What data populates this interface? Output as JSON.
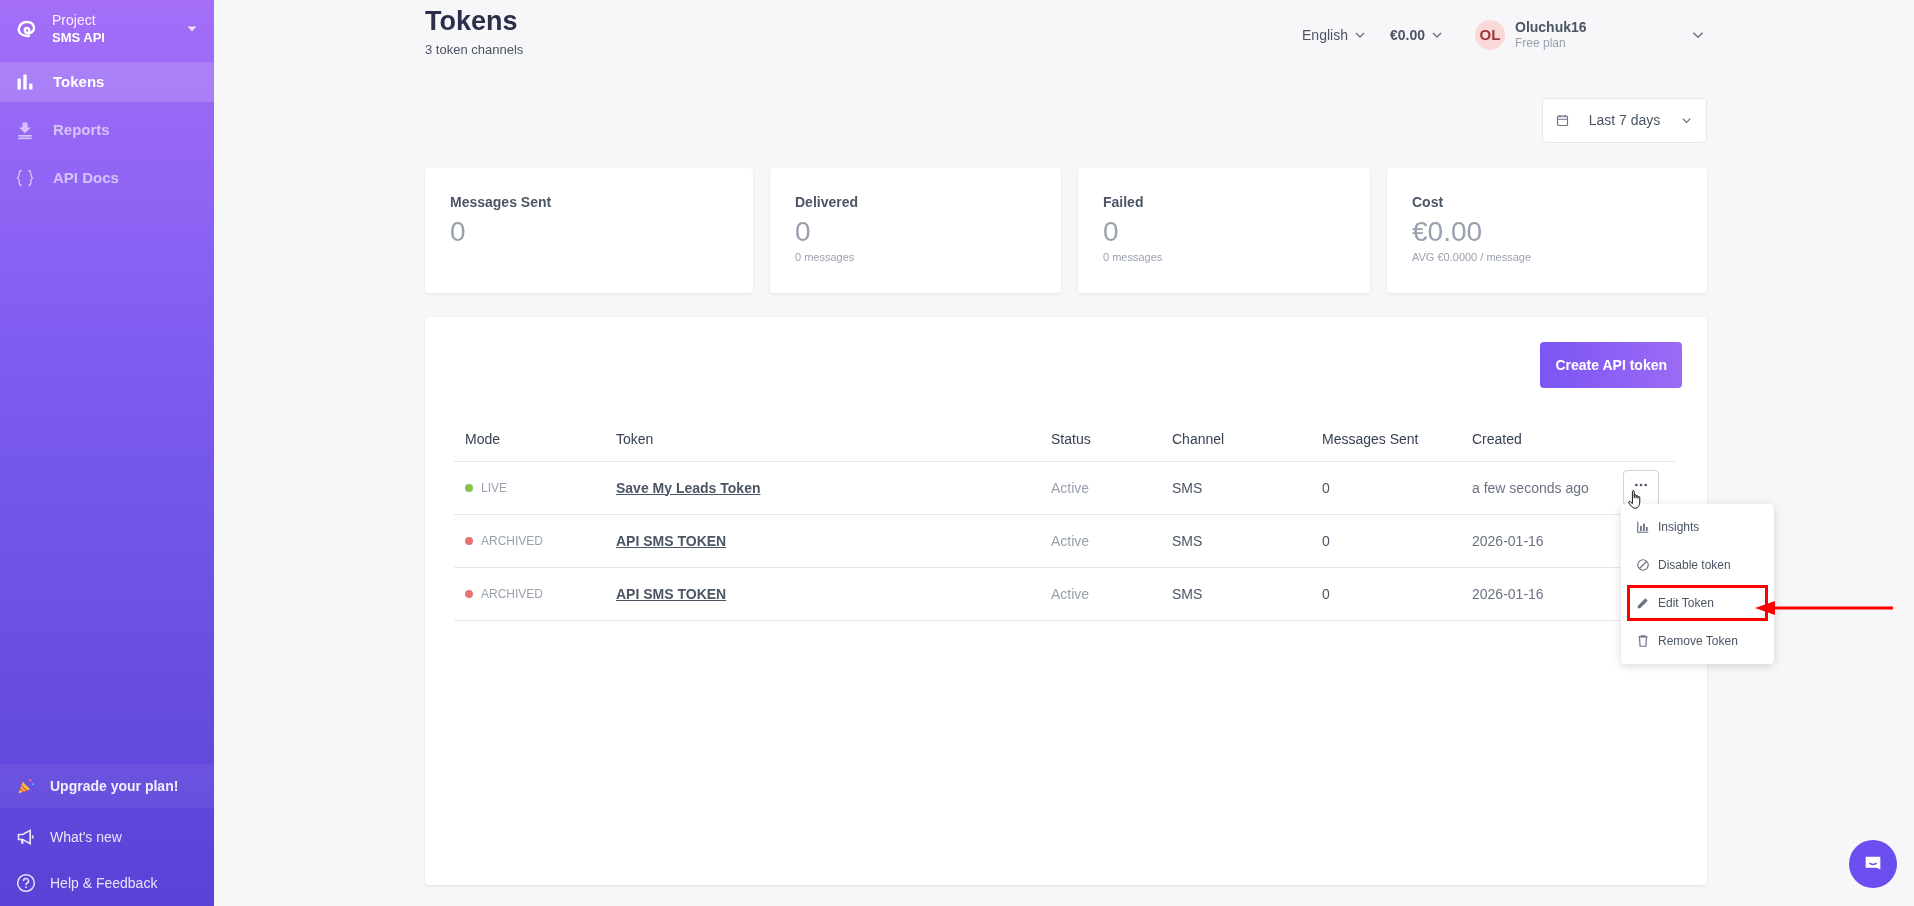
{
  "sidebar": {
    "project_label": "Project",
    "project_name": "SMS API",
    "items": [
      {
        "label": "Tokens",
        "selected": true
      },
      {
        "label": "Reports",
        "selected": false
      },
      {
        "label": "API Docs",
        "selected": false
      }
    ],
    "footer": [
      {
        "label": "Upgrade your plan!",
        "kind": "promo"
      },
      {
        "label": "What's new",
        "kind": "link"
      },
      {
        "label": "Help & Feedback",
        "kind": "link"
      }
    ]
  },
  "header": {
    "title": "Tokens",
    "subtitle": "3 token channels",
    "language": "English",
    "balance": "€0.00",
    "user": {
      "initials": "OL",
      "name": "Oluchuk16",
      "plan": "Free plan"
    }
  },
  "date_range": "Last 7 days",
  "stats": [
    {
      "label": "Messages Sent",
      "value": "0"
    },
    {
      "label": "Delivered",
      "value": "0",
      "note": "0 messages"
    },
    {
      "label": "Failed",
      "value": "0",
      "note": "0 messages"
    },
    {
      "label": "Cost",
      "value": "€0.00",
      "note": "AVG €0.0000 / message"
    }
  ],
  "create_button": "Create API token",
  "table": {
    "columns": [
      "Mode",
      "Token",
      "Status",
      "Channel",
      "Messages Sent",
      "Created"
    ],
    "rows": [
      {
        "mode": "LIVE",
        "color": "#8bc34a",
        "token": "Save My Leads Token",
        "status": "Active",
        "channel": "SMS",
        "messages_sent": "0",
        "created": "a few seconds ago",
        "menu_open": true
      },
      {
        "mode": "ARCHIVED",
        "color": "#e57373",
        "token": "API SMS TOKEN",
        "status": "Active",
        "channel": "SMS",
        "messages_sent": "0",
        "created": "2026-01-16",
        "menu_open": false
      },
      {
        "mode": "ARCHIVED",
        "color": "#e57373",
        "token": "API SMS TOKEN",
        "status": "Active",
        "channel": "SMS",
        "messages_sent": "0",
        "created": "2026-01-16",
        "menu_open": false
      }
    ]
  },
  "row_menu": [
    {
      "label": "Insights",
      "highlighted": false
    },
    {
      "label": "Disable token",
      "highlighted": false
    },
    {
      "label": "Edit Token",
      "highlighted": true
    },
    {
      "label": "Remove Token",
      "highlighted": false
    }
  ]
}
